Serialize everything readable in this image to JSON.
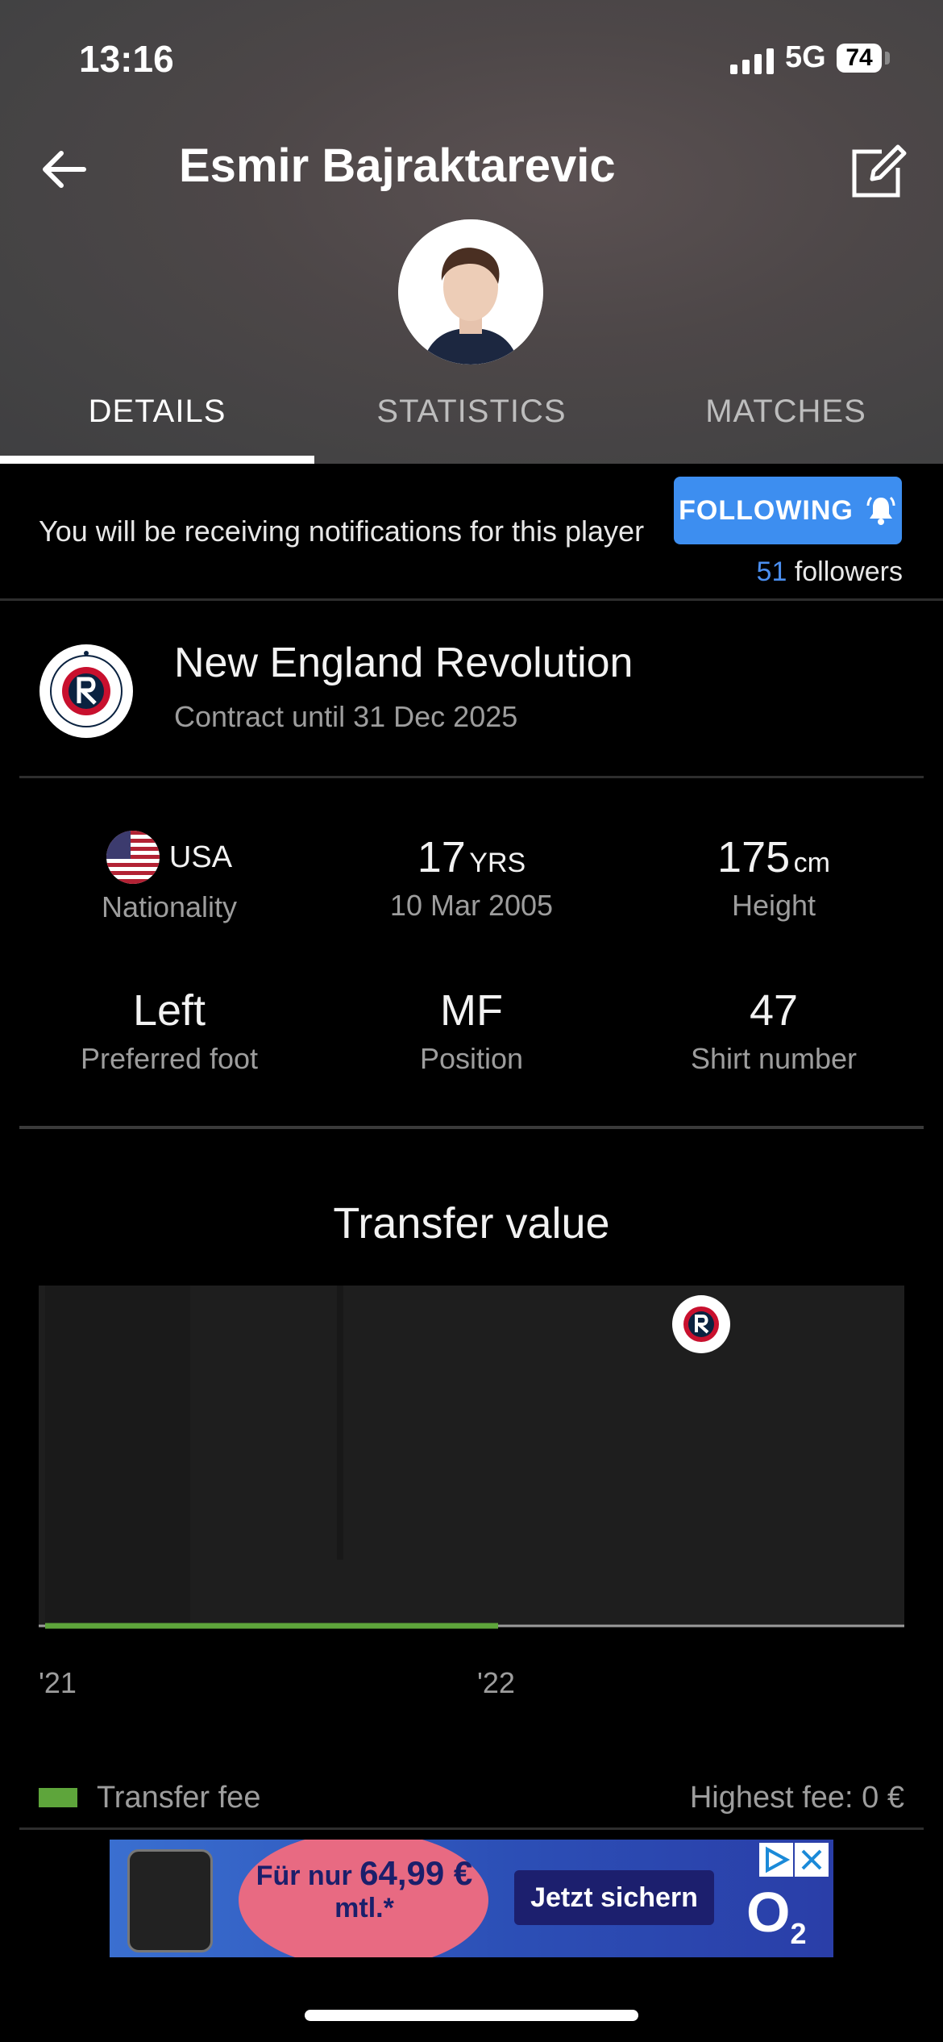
{
  "status_bar": {
    "time": "13:16",
    "network": "5G",
    "battery": "74"
  },
  "header": {
    "title": "Esmir Bajraktarevic"
  },
  "tabs": [
    {
      "label": "DETAILS",
      "active": true
    },
    {
      "label": "STATISTICS",
      "active": false
    },
    {
      "label": "MATCHES",
      "active": false
    }
  ],
  "notification": {
    "text": "You will be receiving notifications for this player",
    "button_label": "FOLLOWING",
    "followers_count": "51",
    "followers_label": "followers"
  },
  "club": {
    "name": "New England Revolution",
    "contract": "Contract until 31 Dec 2025"
  },
  "stats": {
    "nationality": {
      "value": "USA",
      "label": "Nationality"
    },
    "age": {
      "value": "17",
      "unit": "YRS",
      "label": "10 Mar 2005"
    },
    "height": {
      "value": "175",
      "unit": "cm",
      "label": "Height"
    },
    "foot": {
      "value": "Left",
      "label": "Preferred foot"
    },
    "position": {
      "value": "MF",
      "label": "Position"
    },
    "shirt": {
      "value": "47",
      "label": "Shirt number"
    }
  },
  "transfer": {
    "title": "Transfer value",
    "x_labels": [
      "'21",
      "'22"
    ],
    "legend_label": "Transfer fee",
    "highest_fee": "Highest fee: 0 €"
  },
  "ad": {
    "price_prefix": "Für nur",
    "price": "64,99 €",
    "price_suffix": "mtl.*",
    "cta": "Jetzt sichern",
    "brand": "O",
    "brand_sub": "2"
  },
  "colors": {
    "accent": "#3d8ef0",
    "transfer_line": "#5ea53b",
    "club_red": "#c8102e",
    "club_navy": "#0a2240"
  }
}
